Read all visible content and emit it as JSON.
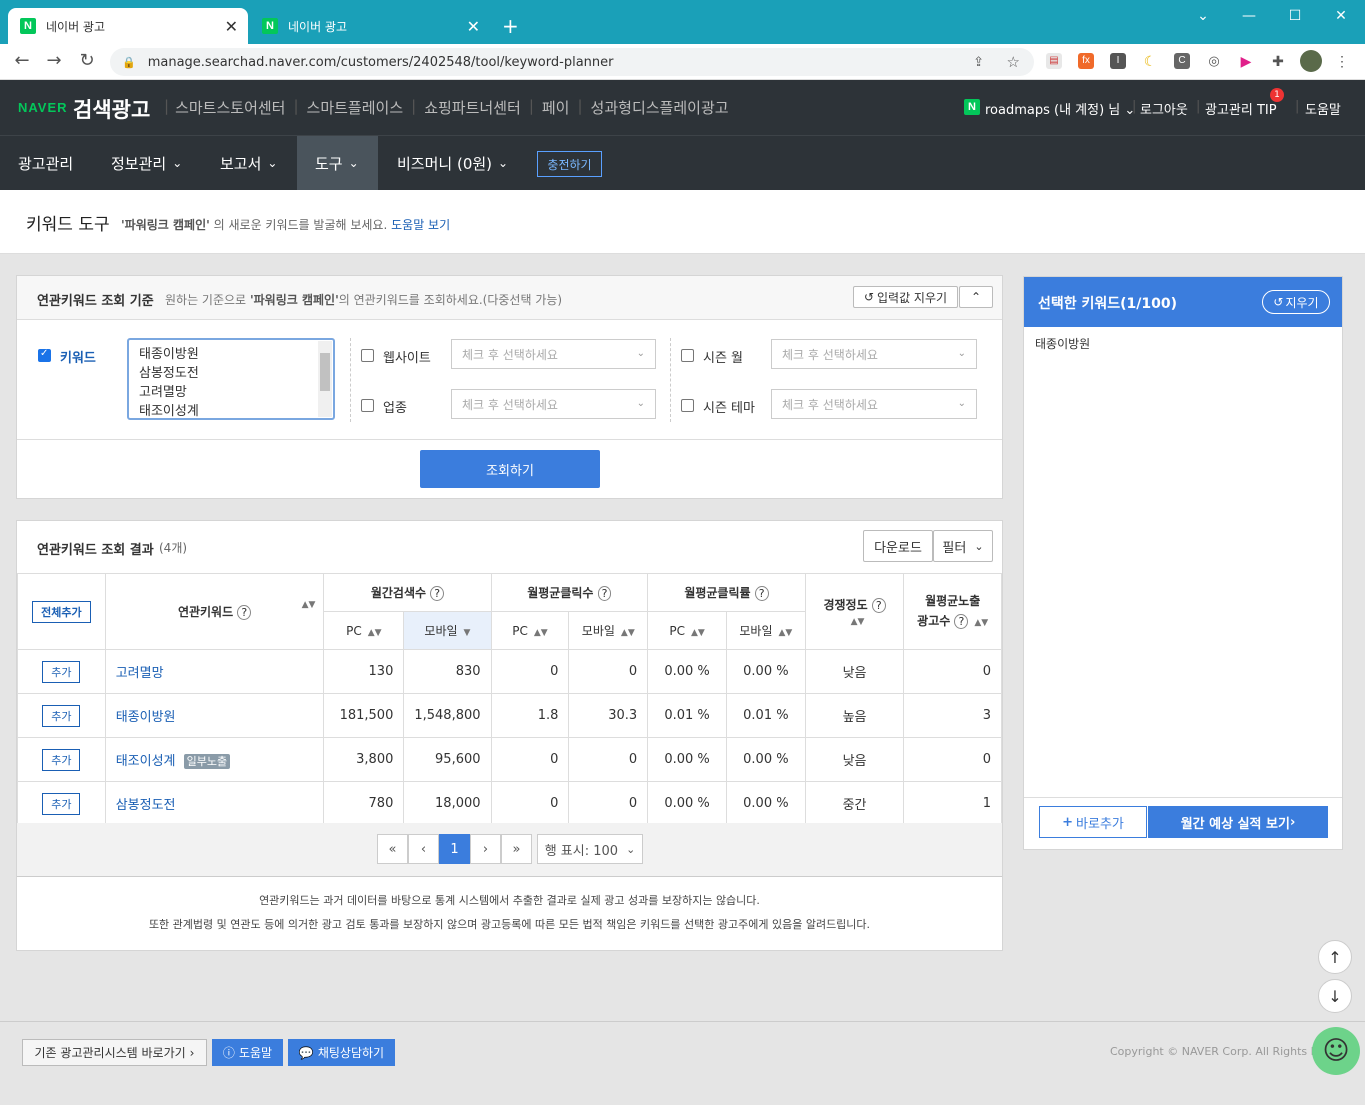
{
  "browser": {
    "tabs": [
      {
        "label": "네이버 광고"
      },
      {
        "label": "네이버 광고"
      }
    ],
    "url": "manage.searchad.naver.com/customers/2402548/tool/keyword-planner"
  },
  "header": {
    "logo_naver": "NAVER",
    "logo_service": "검색광고",
    "links": [
      "스마트스토어센터",
      "스마트플레이스",
      "쇼핑파트너센터",
      "페이",
      "성과형디스플레이광고"
    ],
    "account": "roadmaps (내 계정) 님",
    "logout": "로그아웃",
    "tip": "광고관리 TIP",
    "tip_badge": "1",
    "help": "도움말"
  },
  "menu": {
    "items": [
      "광고관리",
      "정보관리",
      "보고서",
      "도구",
      "비즈머니 (0원)"
    ],
    "charge": "충전하기"
  },
  "page": {
    "title": "키워드 도구",
    "campaign": "'파워링크 캠페인'",
    "desc": "의 새로운 키워드를 발굴해 보세요.",
    "help_link": "도움말 보기"
  },
  "criteria": {
    "title": "연관키워드 조회 기준",
    "desc_pre": "원하는 기준으로",
    "campaign": "'파워링크 캠페인'",
    "desc_post": "의 연관키워드를 조회하세요.(다중선택 가능)",
    "reset": "입력값 지우기",
    "keyword_label": "키워드",
    "keywords": [
      "태종이방원",
      "삼봉정도전",
      "고려멸망",
      "태조이성계"
    ],
    "website_label": "웹사이트",
    "industry_label": "업종",
    "season_month_label": "시즌 월",
    "season_theme_label": "시즌 테마",
    "select_placeholder": "체크 후 선택하세요",
    "search_button": "조회하기"
  },
  "results": {
    "title": "연관키워드 조회 결과",
    "count": "(4개)",
    "download": "다운로드",
    "filter": "필터",
    "add_all": "전체추가",
    "col_keyword": "연관키워드",
    "col_monthly_search": "월간검색수",
    "col_monthly_clicks": "월평균클릭수",
    "col_monthly_ctr": "월평균클릭률",
    "col_competition": "경쟁정도",
    "col_ad_count_1": "월평균노출",
    "col_ad_count_2": "광고수",
    "sub_pc": "PC",
    "sub_mobile": "모바일",
    "add": "추가",
    "rows": [
      {
        "keyword": "고려멸망",
        "badge": "",
        "pc": "130",
        "mobile": "830",
        "click_pc": "0",
        "click_mobile": "0",
        "ctr_pc": "0.00 %",
        "ctr_mobile": "0.00 %",
        "competition": "낮음",
        "ads": "0"
      },
      {
        "keyword": "태종이방원",
        "badge": "",
        "pc": "181,500",
        "mobile": "1,548,800",
        "click_pc": "1.8",
        "click_mobile": "30.3",
        "ctr_pc": "0.01 %",
        "ctr_mobile": "0.01 %",
        "competition": "높음",
        "ads": "3"
      },
      {
        "keyword": "태조이성계",
        "badge": "일부노출",
        "pc": "3,800",
        "mobile": "95,600",
        "click_pc": "0",
        "click_mobile": "0",
        "ctr_pc": "0.00 %",
        "ctr_mobile": "0.00 %",
        "competition": "낮음",
        "ads": "0"
      },
      {
        "keyword": "삼봉정도전",
        "badge": "",
        "pc": "780",
        "mobile": "18,000",
        "click_pc": "0",
        "click_mobile": "0",
        "ctr_pc": "0.00 %",
        "ctr_mobile": "0.00 %",
        "competition": "중간",
        "ads": "1"
      }
    ],
    "page": "1",
    "rows_per_page": "행 표시: 100",
    "notice_1": "연관키워드는 과거 데이터를 바탕으로 통계 시스템에서 추출한 결과로 실제 광고 성과를 보장하지는 않습니다.",
    "notice_2": "또한 관계법령 및 연관도 등에 의거한 광고 검토 통과를 보장하지 않으며 광고등록에 따른 모든 법적 책임은 키워드를 선택한 광고주에게 있음을 알려드립니다."
  },
  "selected": {
    "title": "선택한 키워드(1/100)",
    "clear": "지우기",
    "items": [
      "태종이방원"
    ],
    "add_now": "바로추가",
    "forecast": "월간 예상 실적 보기"
  },
  "footer": {
    "legacy": "기존 광고관리시스템 바로가기",
    "help": "도움말",
    "chat": "채팅상담하기",
    "copyright": "Copyright © NAVER Corp. All Rights Res"
  },
  "colors": {
    "accent": "#3b7ddd",
    "header_bg": "#2d3338",
    "tab_bg": "#1aa0b8",
    "naver_green": "#03c75a"
  }
}
